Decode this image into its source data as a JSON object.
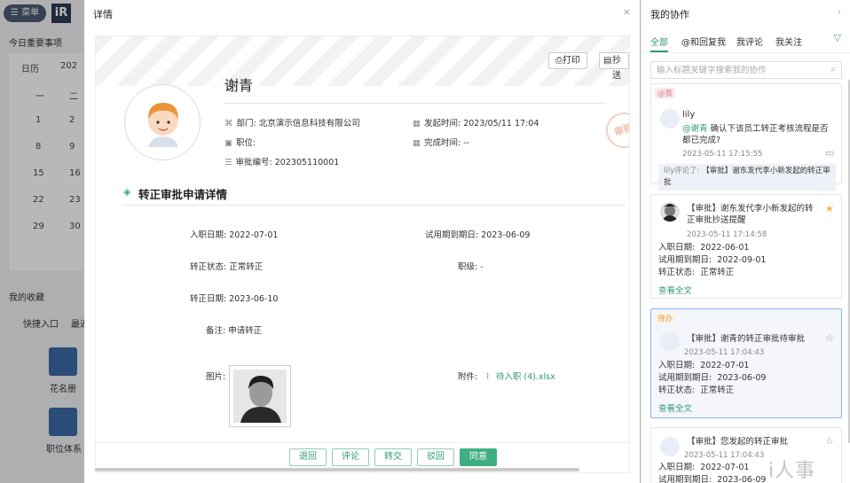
{
  "background": {
    "menu_label": "☰ 菜单",
    "logo": "iR",
    "today_title": "今日重要事项",
    "calendar_tab": "日历",
    "calendar_month": "202",
    "weekdays": [
      "一",
      "二"
    ],
    "calendar_rows": [
      [
        "1",
        "2"
      ],
      [
        "8",
        "9"
      ],
      [
        "15",
        "16"
      ],
      [
        "22",
        "23"
      ],
      [
        "29",
        "30"
      ]
    ],
    "favorites_title": "我的收藏",
    "fav_tabs": [
      "快捷入口",
      "最近"
    ],
    "shortcuts": [
      "花名册",
      "职位体系"
    ]
  },
  "modal": {
    "title": "详情",
    "close": "×",
    "print_label": "⎙打印",
    "copy_label": "抄送",
    "name": "谢青",
    "dept_label": "部门:",
    "dept_value": "北京演示信息科技有限公司",
    "position_label": "职位:",
    "position_value": "",
    "approval_no_label": "审批编号:",
    "approval_no_value": "202305110001",
    "start_time_label": "发起时间:",
    "start_time_value": "2023/05/11 17:04",
    "finish_time_label": "完成时间:",
    "finish_time_value": "--",
    "stamp": "审批",
    "section_title": "转正审批申请详情",
    "fields": {
      "entry_label": "入职日期:",
      "entry_value": "2022-07-01",
      "probation_label": "试用期到期日:",
      "probation_value": "2023-06-09",
      "status_label": "转正状态:",
      "status_value": "正常转正",
      "level_label": "职级:",
      "level_value": "-",
      "regular_label": "转正日期:",
      "regular_value": "2023-06-10",
      "note_label": "备注:",
      "note_value": "申请转正",
      "image_label": "图片:",
      "attach_label": "附件:",
      "attach_value": "待入职 (4).xlsx"
    },
    "actions": [
      "退回",
      "评论",
      "转交",
      "驳回",
      "同意"
    ]
  },
  "sidebar": {
    "title": "我的协作",
    "arrow": "›",
    "tabs": [
      "全部",
      "@和回复我",
      "我评论",
      "我关注"
    ],
    "active_tab": 0,
    "search_placeholder": "输入标题关键字搜索我的协作",
    "cards": [
      {
        "tag": "@我",
        "user": "lily",
        "mention": "@谢青",
        "message": "确认下该员工转正考核流程是否都已完成?",
        "time": "2023-05-11 17:15:55",
        "footer_user": "lily评论了:",
        "footer_text": "【审批】谢东发代李小新发起的转正审批"
      },
      {
        "title": "【审批】谢东发代李小新发起的转正审批抄送提醒",
        "time": "2023-05-11 17:14:58",
        "lines": [
          {
            "label": "入职日期:",
            "value": "2022-06-01"
          },
          {
            "label": "试用期到期日:",
            "value": "2022-09-01"
          },
          {
            "label": "转正状态:",
            "value": "正常转正"
          }
        ],
        "link": "查看全文",
        "starred": true
      },
      {
        "tag": "待办",
        "title": "【审批】谢青的转正审批待审批",
        "time": "2023-05-11 17:04:43",
        "lines": [
          {
            "label": "入职日期:",
            "value": "2022-07-01"
          },
          {
            "label": "试用期到期日:",
            "value": "2023-06-09"
          },
          {
            "label": "转正状态:",
            "value": "正常转正"
          }
        ],
        "link": "查看全文",
        "starred": false
      },
      {
        "title": "【审批】您发起的转正审批",
        "time": "2023-05-11 17:04:43",
        "lines": [
          {
            "label": "入职日期:",
            "value": "2022-07-01"
          },
          {
            "label": "试用期到期日:",
            "value": "2023-06-09"
          }
        ],
        "starred": false
      }
    ]
  },
  "watermark": "i人事",
  "colors": {
    "accent": "#3fae82",
    "link": "#2f9a72",
    "selected_border": "#8ab4e8"
  }
}
